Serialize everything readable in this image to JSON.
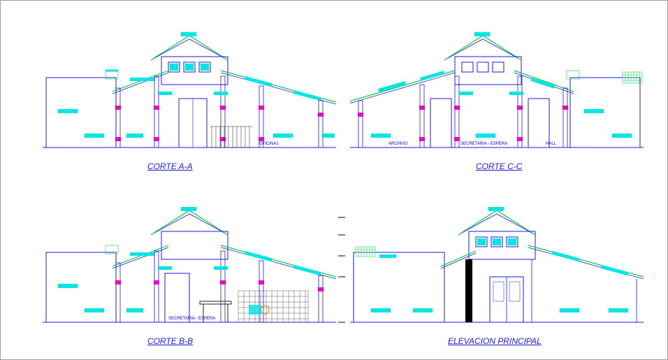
{
  "drawings": {
    "aa": {
      "title": "CORTE A-A",
      "rooms": [
        "OFICINA1"
      ]
    },
    "cc": {
      "title": "CORTE C-C",
      "rooms": [
        "ARCHIVO",
        "SECRETARIA - ESPERA",
        "HALL"
      ]
    },
    "bb": {
      "title": "CORTE B-B",
      "rooms": [
        "SECRETARIA - ESPERA"
      ]
    },
    "ep": {
      "title": "ELEVACION PRINCIPAL",
      "rooms": []
    }
  },
  "colors": {
    "outline": "#1a1aee",
    "roof": "#00cc44",
    "highlight": "#00e5e5",
    "magenta": "#ee00cc",
    "grid": "#333333"
  }
}
